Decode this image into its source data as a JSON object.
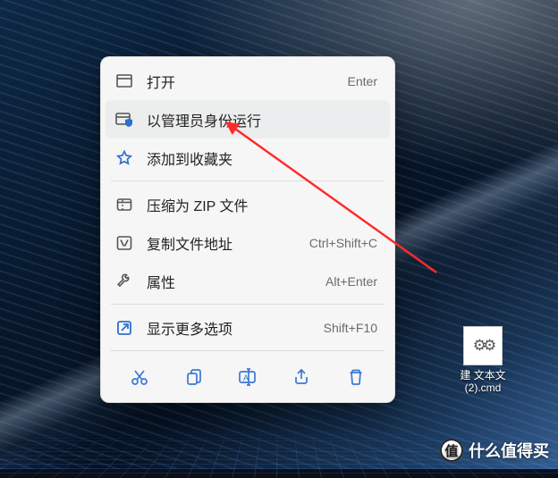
{
  "menu": {
    "open": {
      "label": "打开",
      "shortcut": "Enter"
    },
    "run_admin": {
      "label": "以管理员身份运行",
      "shortcut": ""
    },
    "favorite": {
      "label": "添加到收藏夹",
      "shortcut": ""
    },
    "zip": {
      "label": "压缩为 ZIP 文件",
      "shortcut": ""
    },
    "copy_path": {
      "label": "复制文件地址",
      "shortcut": "Ctrl+Shift+C"
    },
    "properties": {
      "label": "属性",
      "shortcut": "Alt+Enter"
    },
    "more": {
      "label": "显示更多选项",
      "shortcut": "Shift+F10"
    }
  },
  "toolbar_order": [
    "cut",
    "copy",
    "rename",
    "share",
    "delete"
  ],
  "desktop_file": {
    "name": "建 文本文\n(2).cmd"
  },
  "highlight": "run_admin",
  "colors": {
    "accent": "#3a78d6",
    "arrow": "#ff2a2a"
  },
  "watermark": "什么值得买"
}
